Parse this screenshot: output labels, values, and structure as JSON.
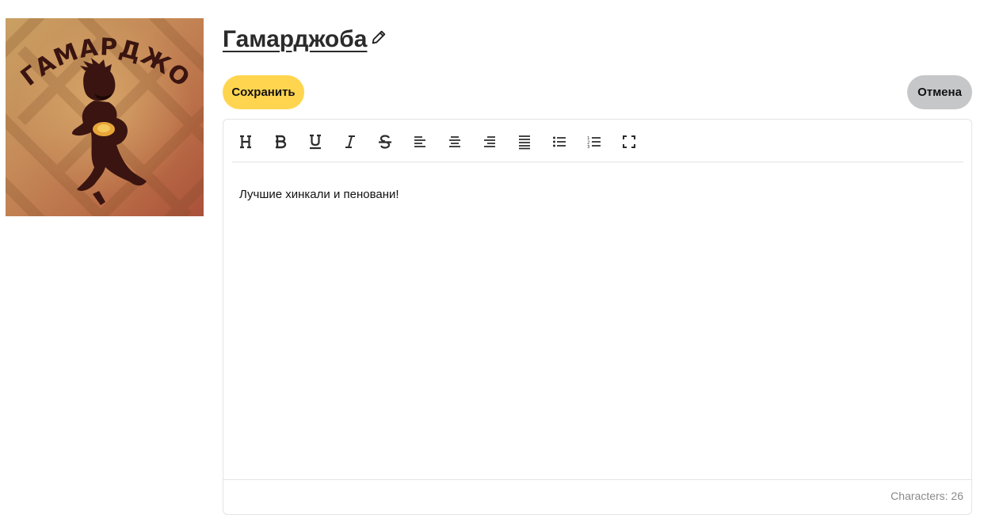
{
  "logo": {
    "text": "ГАМАРДЖОБА",
    "icon": "restaurant-logo-dancer"
  },
  "header": {
    "title": "Гамарджоба",
    "edit_icon": "pencil-icon"
  },
  "actions": {
    "save_label": "Сохранить",
    "cancel_label": "Отмена"
  },
  "toolbar": {
    "buttons": [
      {
        "name": "heading",
        "icon": "heading-icon"
      },
      {
        "name": "bold",
        "icon": "bold-icon"
      },
      {
        "name": "underline",
        "icon": "underline-icon"
      },
      {
        "name": "italic",
        "icon": "italic-icon"
      },
      {
        "name": "strikethrough",
        "icon": "strikethrough-icon"
      },
      {
        "name": "align-left",
        "icon": "align-left-icon"
      },
      {
        "name": "align-center",
        "icon": "align-center-icon"
      },
      {
        "name": "align-right",
        "icon": "align-right-icon"
      },
      {
        "name": "justify",
        "icon": "justify-icon"
      },
      {
        "name": "bullet-list",
        "icon": "bullet-list-icon"
      },
      {
        "name": "numbered-list",
        "icon": "numbered-list-icon"
      },
      {
        "name": "fullscreen",
        "icon": "fullscreen-icon"
      }
    ]
  },
  "editor": {
    "content": "Лучшие хинкали и пеновани!"
  },
  "footer": {
    "characters": "Characters: 26"
  },
  "colors": {
    "save": "#ffd54f",
    "cancel": "#c5c7c9",
    "border": "#e4e4e4"
  }
}
